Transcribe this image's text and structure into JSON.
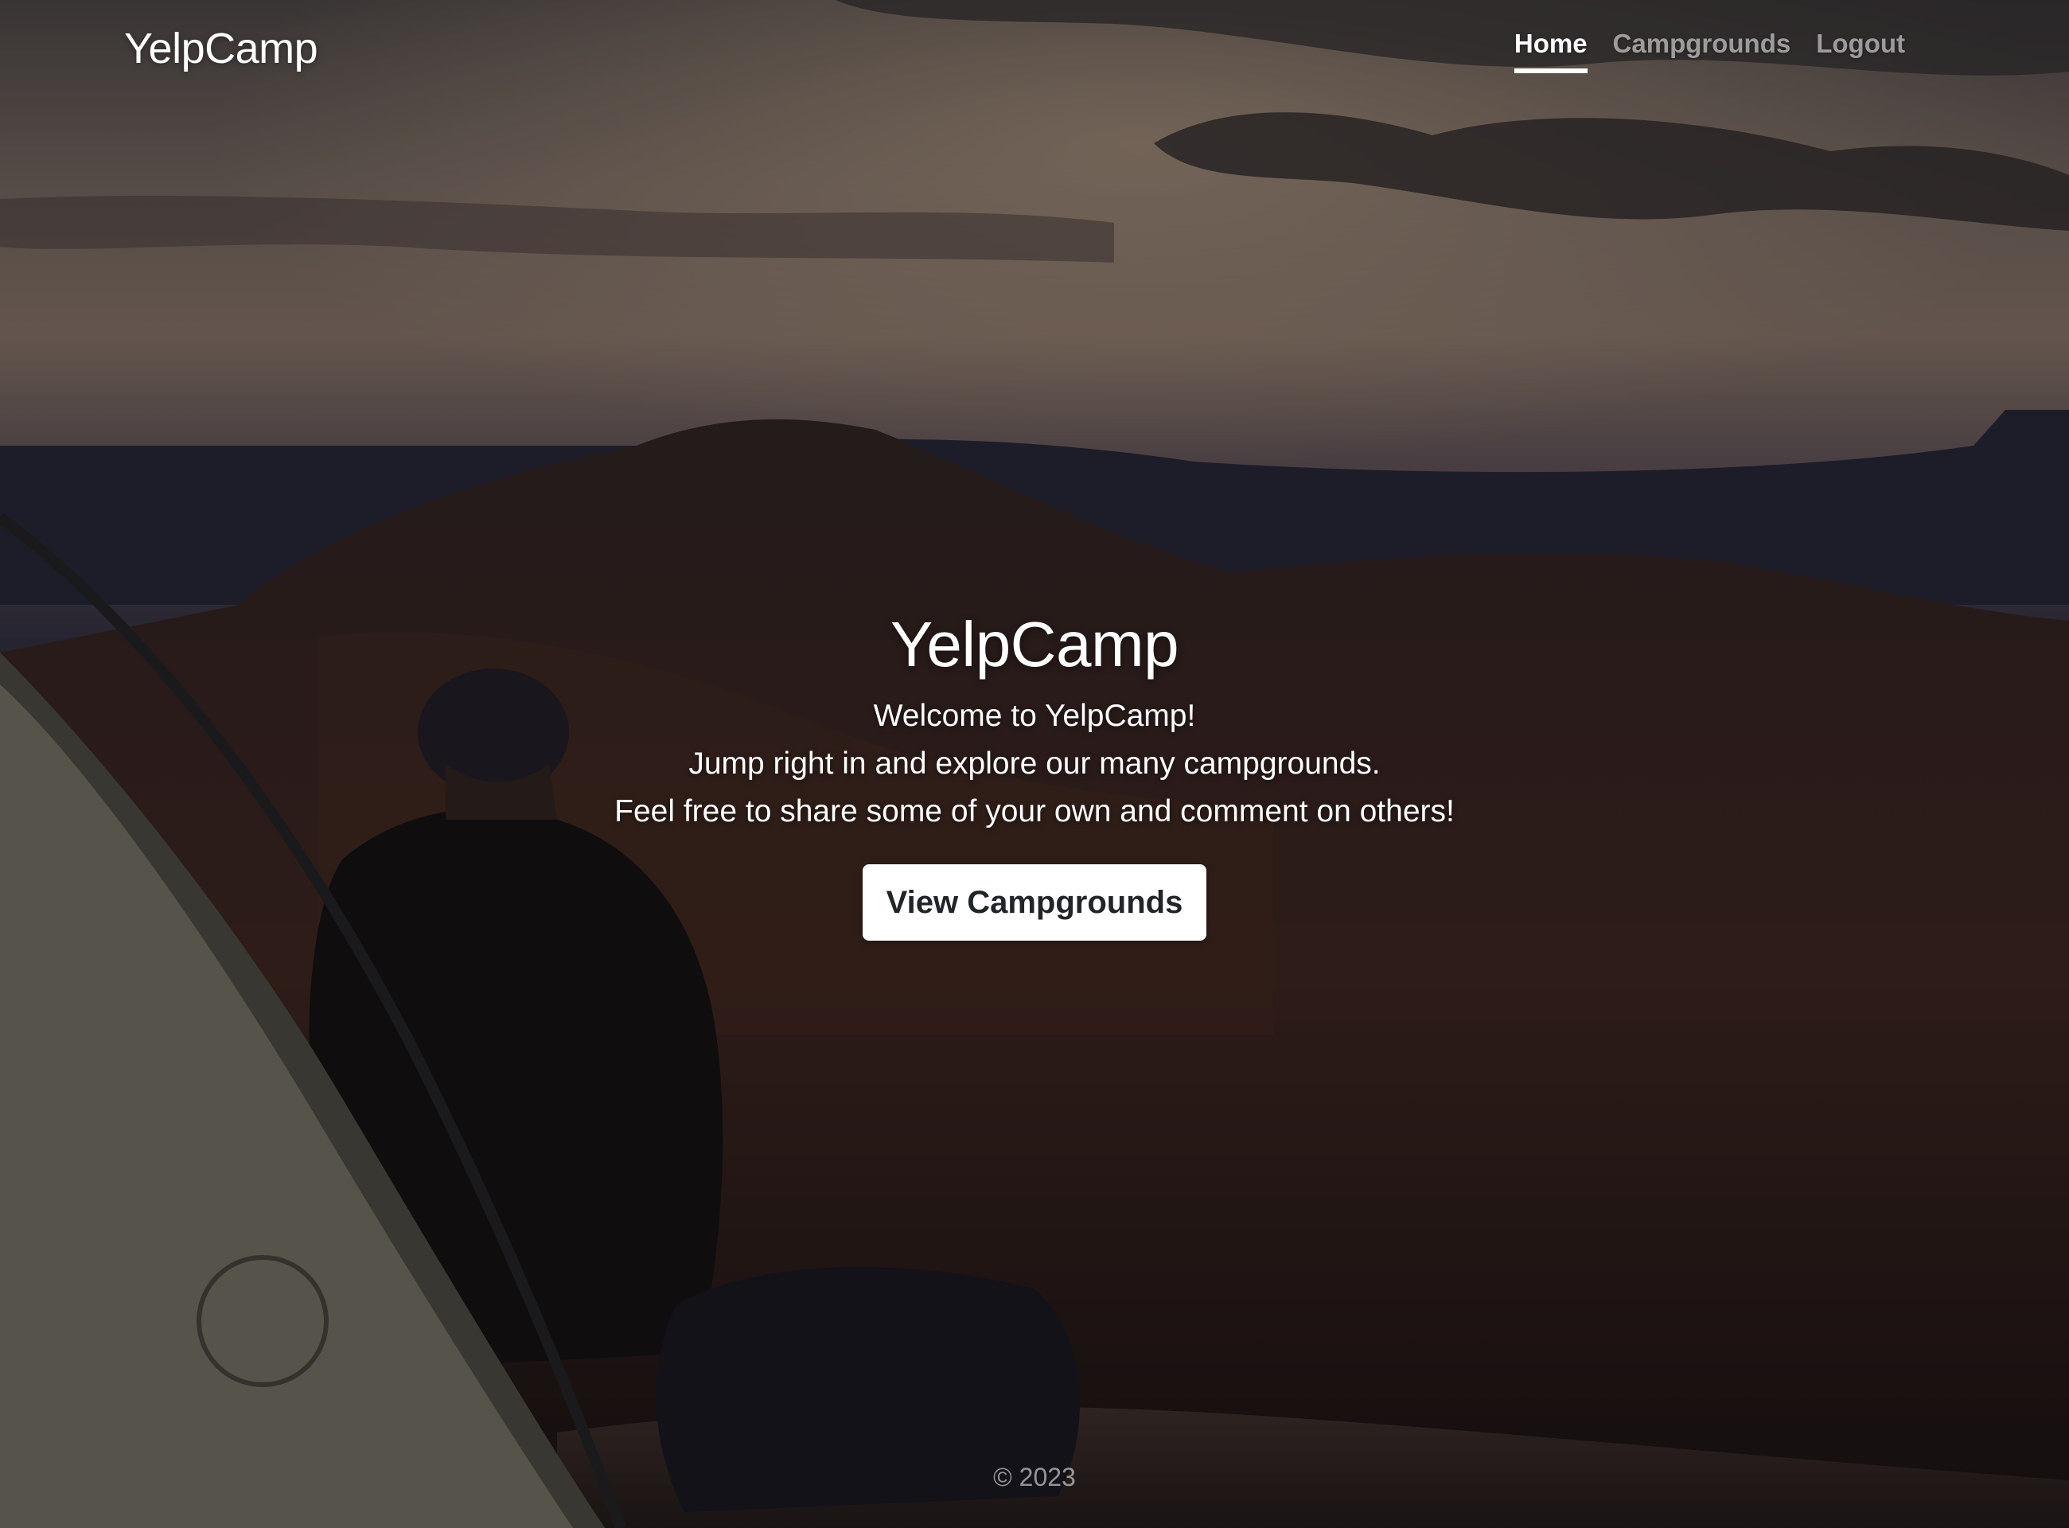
{
  "navbar": {
    "brand": "YelpCamp",
    "links": [
      {
        "label": "Home",
        "active": true
      },
      {
        "label": "Campgrounds",
        "active": false
      },
      {
        "label": "Logout",
        "active": false
      }
    ]
  },
  "hero": {
    "title": "YelpCamp",
    "lines": [
      "Welcome to YelpCamp!",
      "Jump right in and explore our many campgrounds.",
      "Feel free to share some of your own and comment on others!"
    ],
    "button_label": "View Campgrounds"
  },
  "footer": {
    "text": "© 2023"
  },
  "colors": {
    "overlay": "rgba(0,0,0,0.38)",
    "nav_active": "#ffffff",
    "nav_inactive": "rgba(255,255,255,0.55)",
    "button_bg": "#ffffff",
    "button_text": "#212529"
  }
}
